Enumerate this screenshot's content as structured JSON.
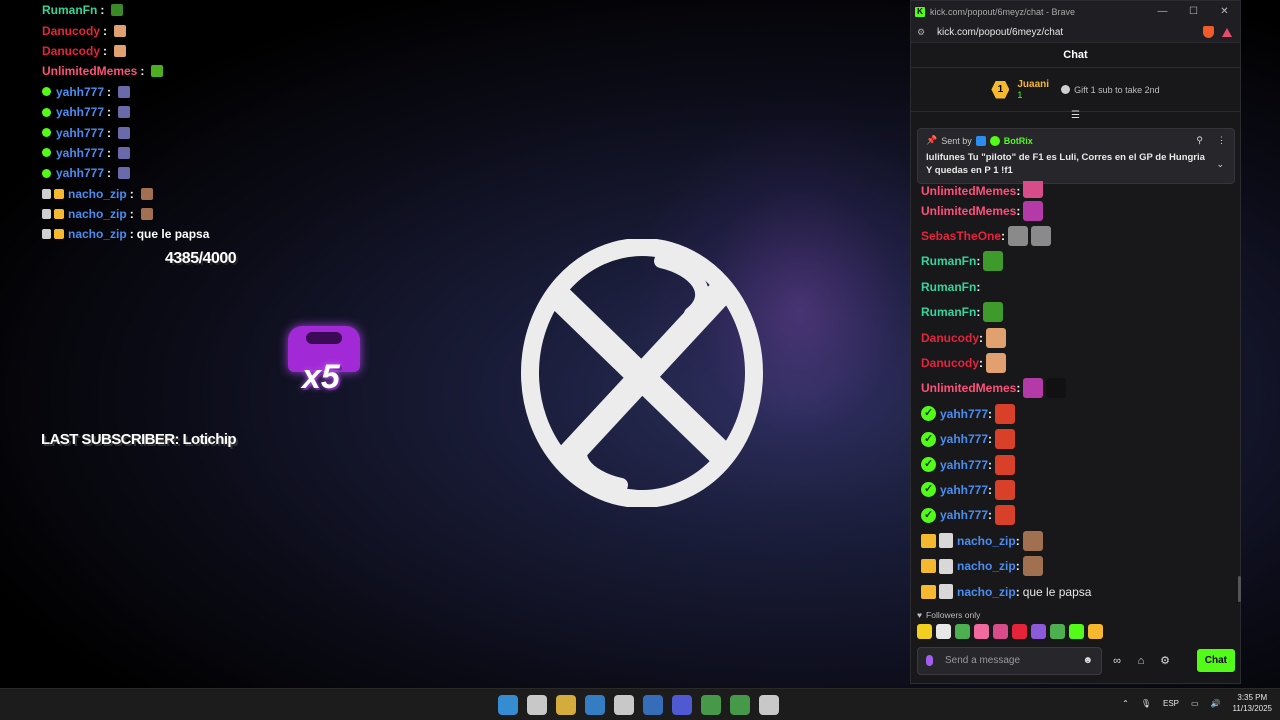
{
  "overlay": {
    "chat_lines": [
      {
        "user": "RumanFn",
        "color": "#35d49a",
        "badge": "none",
        "emote": "#3a8a2a",
        "text": ""
      },
      {
        "user": "Danucody",
        "color": "#e5243b",
        "badge": "none",
        "emote": "#e0a070",
        "text": ""
      },
      {
        "user": "Danucody",
        "color": "#e5243b",
        "badge": "none",
        "emote": "#e0a070",
        "text": ""
      },
      {
        "user": "UnlimitedMemes",
        "color": "#ff4f7a",
        "badge": "none",
        "emote": "#4caf20",
        "text": ""
      },
      {
        "user": "yahh777",
        "color": "#4a8df0",
        "badge": "check",
        "emote": "#6a6aaa",
        "text": ""
      },
      {
        "user": "yahh777",
        "color": "#4a8df0",
        "badge": "check",
        "emote": "#6a6aaa",
        "text": ""
      },
      {
        "user": "yahh777",
        "color": "#4a8df0",
        "badge": "check",
        "emote": "#6a6aaa",
        "text": ""
      },
      {
        "user": "yahh777",
        "color": "#4a8df0",
        "badge": "check",
        "emote": "#6a6aaa",
        "text": ""
      },
      {
        "user": "yahh777",
        "color": "#4a8df0",
        "badge": "check",
        "emote": "#6a6aaa",
        "text": ""
      },
      {
        "user": "nacho_zip",
        "color": "#4a8df0",
        "badge": "sub",
        "emote": "#a07050",
        "text": ""
      },
      {
        "user": "nacho_zip",
        "color": "#4a8df0",
        "badge": "sub",
        "emote": "#a07050",
        "text": ""
      },
      {
        "user": "nacho_zip",
        "color": "#4a8df0",
        "badge": "sub",
        "emote": "",
        "text": "que le papsa"
      }
    ],
    "separator": ":",
    "sub_goal": "4385/4000",
    "last_subscriber": "LAST SUBSCRIBER: Lotichip",
    "combo_multiplier": "x5"
  },
  "browser": {
    "title": "kick.com/popout/6meyz/chat - Brave",
    "url": "kick.com/popout/6meyz/chat",
    "window_controls": [
      "—",
      "☐",
      "✕"
    ],
    "brand_color": "#53fc18"
  },
  "chat": {
    "header": "Chat",
    "leaderboard": {
      "rank": "1",
      "name": "Juaani",
      "count": "1",
      "gift_text": "Gift 1 sub to take 2nd"
    },
    "pinned": {
      "sent_by_label": "Sent by",
      "bot_name": "BotRix",
      "message": "lulifunes Tu \"piloto\" de F1 es Luli, Corres en el GP de Hungria Y quedas en P 1 !f1"
    },
    "messages": [
      {
        "user": "UnlimitedMemes",
        "color": "#ff4f7a",
        "badges": [],
        "emotes": [
          "#d94c8a"
        ],
        "text": "",
        "partial": true
      },
      {
        "user": "UnlimitedMemes",
        "color": "#ff4f7a",
        "badges": [],
        "emotes": [
          "#b43aa8"
        ],
        "text": ""
      },
      {
        "user": "SebasTheOne",
        "color": "#e5243b",
        "badges": [],
        "emotes": [
          "#8a8a8a",
          "#8a8a8a"
        ],
        "text": ""
      },
      {
        "user": "RumanFn",
        "color": "#35d49a",
        "badges": [],
        "emotes": [
          "#3f9a2c"
        ],
        "text": ""
      },
      {
        "user": "RumanFn",
        "color": "#35d49a",
        "badges": [],
        "emotes": [],
        "text": ""
      },
      {
        "user": "RumanFn",
        "color": "#35d49a",
        "badges": [],
        "emotes": [
          "#3f9a2c"
        ],
        "text": ""
      },
      {
        "user": "Danucody",
        "color": "#e5243b",
        "badges": [],
        "emotes": [
          "#e0a070"
        ],
        "text": ""
      },
      {
        "user": "Danucody",
        "color": "#e5243b",
        "badges": [],
        "emotes": [
          "#e0a070"
        ],
        "text": ""
      },
      {
        "user": "UnlimitedMemes",
        "color": "#ff4f7a",
        "badges": [],
        "emotes": [
          "#b43aa8",
          "#111111"
        ],
        "text": ""
      },
      {
        "user": "yahh777",
        "color": "#4a8df0",
        "badges": [
          "verified"
        ],
        "emotes": [
          "#d8402a"
        ],
        "text": ""
      },
      {
        "user": "yahh777",
        "color": "#4a8df0",
        "badges": [
          "verified"
        ],
        "emotes": [
          "#d8402a"
        ],
        "text": ""
      },
      {
        "user": "yahh777",
        "color": "#4a8df0",
        "badges": [
          "verified"
        ],
        "emotes": [
          "#d8402a"
        ],
        "text": ""
      },
      {
        "user": "yahh777",
        "color": "#4a8df0",
        "badges": [
          "verified"
        ],
        "emotes": [
          "#d8402a"
        ],
        "text": ""
      },
      {
        "user": "yahh777",
        "color": "#4a8df0",
        "badges": [
          "verified"
        ],
        "emotes": [
          "#d8402a"
        ],
        "text": ""
      },
      {
        "user": "nacho_zip",
        "color": "#4a8df0",
        "badges": [
          "crown",
          "sub"
        ],
        "emotes": [
          "#a07050"
        ],
        "text": ""
      },
      {
        "user": "nacho_zip",
        "color": "#4a8df0",
        "badges": [
          "crown",
          "sub"
        ],
        "emotes": [
          "#a07050"
        ],
        "text": ""
      },
      {
        "user": "nacho_zip",
        "color": "#4a8df0",
        "badges": [
          "crown",
          "sub"
        ],
        "emotes": [],
        "text": "que le papsa"
      }
    ],
    "followers_only": "Followers only",
    "emote_bar": [
      "#f3d020",
      "#e8e8e8",
      "#4caf50",
      "#f06aa0",
      "#d94c8a",
      "#e5243b",
      "#8a5ad8",
      "#4caf50",
      "#53fc18",
      "#f5b82e"
    ],
    "input_placeholder": "Send a message",
    "send_label": "Chat"
  },
  "taskbar": {
    "icons": [
      "windows-start",
      "search",
      "file-explorer",
      "store",
      "obs",
      "vscode",
      "discord",
      "chrome",
      "terminal",
      "settings"
    ],
    "icon_colors": [
      "#3aa0f0",
      "#e6e6e6",
      "#f5c542",
      "#3a8ee0",
      "#e6e6e6",
      "#3a7bd5",
      "#5865f2",
      "#4caf50",
      "#4caf50",
      "#e6e6e6"
    ],
    "language": "ESP",
    "time": "3:35 PM",
    "date": "11/13/2025"
  }
}
